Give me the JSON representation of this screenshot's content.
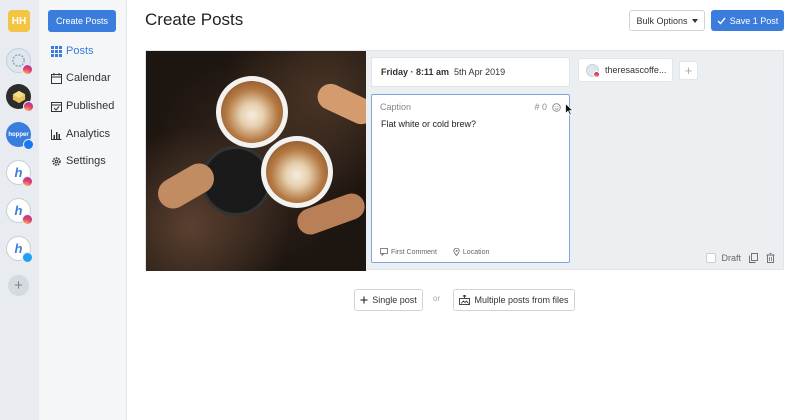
{
  "rail": {
    "workspace_initials": "HH",
    "accounts": [
      {
        "name": "account-1",
        "color": "#dfe7ee",
        "network": "instagram",
        "label": ""
      },
      {
        "name": "account-2",
        "color": "#2c2c2c",
        "network": "instagram",
        "label": ""
      },
      {
        "name": "account-3",
        "color": "#3b7ddd",
        "network": "facebook",
        "label": "hopper"
      },
      {
        "name": "account-4",
        "color": "#ffffff",
        "network": "instagram",
        "label": "h"
      },
      {
        "name": "account-5",
        "color": "#ffffff",
        "network": "instagram",
        "label": "h"
      },
      {
        "name": "account-6",
        "color": "#ffffff",
        "network": "twitter",
        "label": "h"
      }
    ],
    "add_label": "+"
  },
  "nav": {
    "create_label": "Create Posts",
    "items": [
      {
        "label": "Posts",
        "icon": "grid-icon",
        "active": true
      },
      {
        "label": "Calendar",
        "icon": "calendar-icon",
        "active": false
      },
      {
        "label": "Published",
        "icon": "check-calendar-icon",
        "active": false
      },
      {
        "label": "Analytics",
        "icon": "bar-chart-icon",
        "active": false
      },
      {
        "label": "Settings",
        "icon": "gear-icon",
        "active": false
      }
    ]
  },
  "header": {
    "title": "Create Posts",
    "bulk_label": "Bulk Options",
    "save_label": "Save 1 Post"
  },
  "post": {
    "date_day": "Friday · 8:11 am",
    "date_full": "5th Apr 2019",
    "caption_label": "Caption",
    "hashtag_count": "# 0",
    "caption_text": "Flat white or cold brew?",
    "first_comment_label": "First Comment",
    "location_label": "Location",
    "account_name": "theresascoffe...",
    "add_account": "+",
    "draft_label": "Draft"
  },
  "actions": {
    "single_label": "Single post",
    "or_label": "or",
    "multi_label": "Multiple posts from files"
  },
  "colors": {
    "accent": "#3b7ddd",
    "focus_border": "#7ea5e0"
  }
}
